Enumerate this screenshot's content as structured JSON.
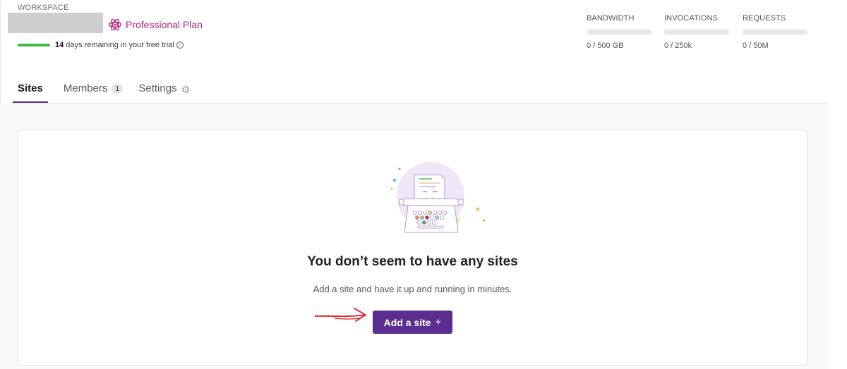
{
  "header": {
    "workspace_label": "WORKSPACE",
    "plan_name": "Professional Plan",
    "trial": {
      "days": "14",
      "text": "days remaining in your free trial",
      "progress_fraction": 0.05
    }
  },
  "usage": [
    {
      "label": "BANDWIDTH",
      "value": "0 / 500 GB",
      "fraction": 0
    },
    {
      "label": "INVOCATIONS",
      "value": "0 / 250k",
      "fraction": 0
    },
    {
      "label": "REQUESTS",
      "value": "0 / 50M",
      "fraction": 0
    }
  ],
  "tabs": [
    {
      "label": "Sites",
      "active": true
    },
    {
      "label": "Members",
      "badge": "1"
    },
    {
      "label": "Settings",
      "icon": "gear-icon"
    }
  ],
  "empty_state": {
    "title": "You don’t seem to have any sites",
    "description": "Add a site and have it up and running in minutes.",
    "button_label": "Add a site",
    "button_icon": "+"
  },
  "colors": {
    "brand_purple": "#5c2d91",
    "plan_pink": "#b5267e",
    "trial_green": "#3cbe3c",
    "annotation_red": "#e01e1e"
  }
}
